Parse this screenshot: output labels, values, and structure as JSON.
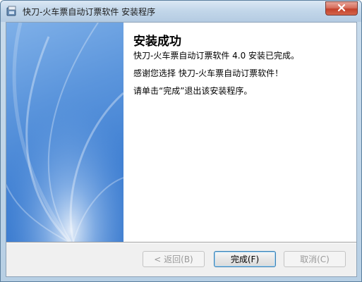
{
  "window": {
    "title": "快刀-火车票自动订票软件 安装程序"
  },
  "content": {
    "heading": "安装成功",
    "line1": "快刀-火车票自动订票软件 4.0 安装已完成。",
    "line2": "感谢您选择 快刀-火车票自动订票软件！",
    "line3": "请单击“完成”退出该安装程序。"
  },
  "buttons": {
    "back": "< 返回(B)",
    "finish": "完成(F)",
    "cancel": "取消(C)"
  },
  "icons": {
    "app": "installer-app-icon",
    "close": "close-icon"
  }
}
